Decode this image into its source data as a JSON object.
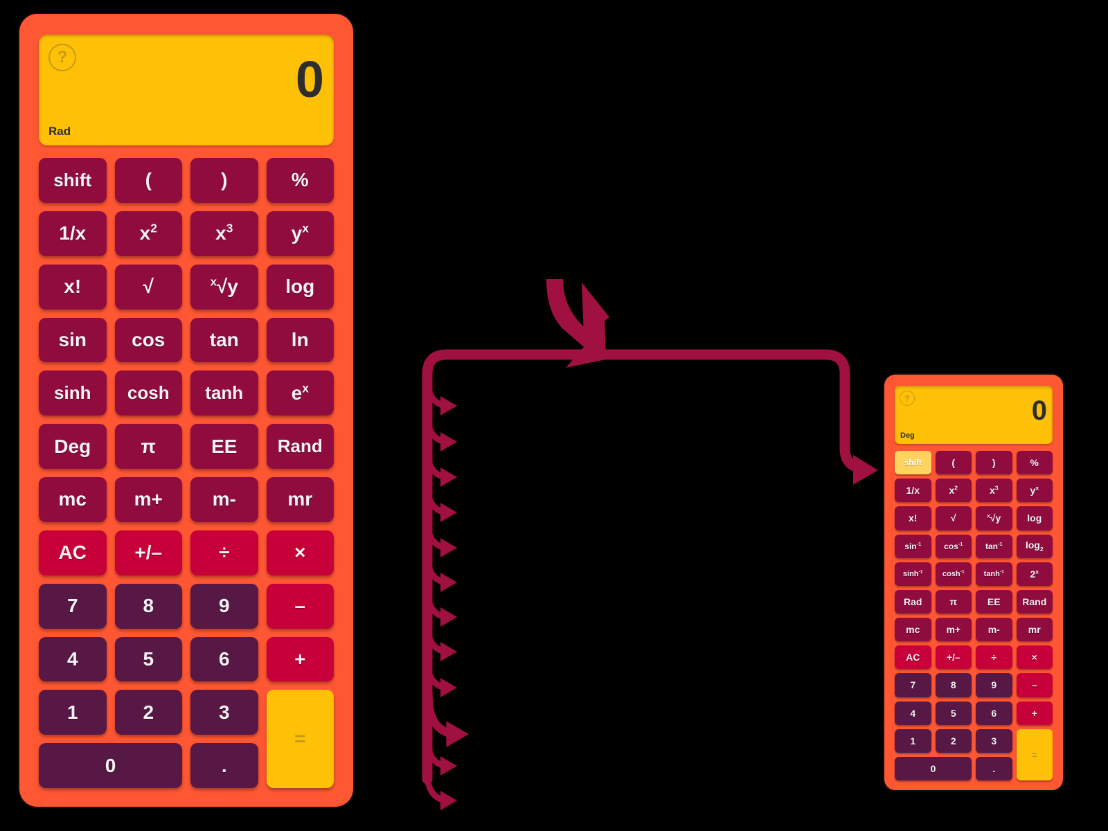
{
  "accent_colors": {
    "body": "#ff5733",
    "display": "#ffc107",
    "function_key": "#900c3f",
    "operator_key": "#c70039",
    "number_key": "#581845",
    "equals_key": "#ffc107",
    "active_key": "#ffd45e",
    "annotation": "#a01040"
  },
  "calculator_main": {
    "name": "scientific-calculator-unshifted",
    "display": {
      "help_icon": "question-mark-icon",
      "value": "0",
      "mode": "Rad"
    },
    "rows": [
      [
        {
          "label": "shift",
          "type": "fn",
          "state": "normal"
        },
        {
          "label": "(",
          "type": "fn",
          "state": "normal"
        },
        {
          "label": ")",
          "type": "fn",
          "state": "normal"
        },
        {
          "label": "%",
          "type": "fn",
          "state": "normal"
        }
      ],
      [
        {
          "label": "1/x",
          "type": "fn",
          "state": "normal"
        },
        {
          "label": "x2",
          "type": "fn",
          "state": "normal",
          "base": "x",
          "sup": "2"
        },
        {
          "label": "x3",
          "type": "fn",
          "state": "normal",
          "base": "x",
          "sup": "3"
        },
        {
          "label": "yx",
          "type": "fn",
          "state": "normal",
          "base": "y",
          "sup": "x"
        }
      ],
      [
        {
          "label": "x!",
          "type": "fn",
          "state": "normal"
        },
        {
          "label": "√",
          "type": "fn",
          "state": "normal"
        },
        {
          "label": "x√y",
          "type": "fn",
          "state": "normal",
          "pre": "x",
          "base": "√y"
        },
        {
          "label": "log",
          "type": "fn",
          "state": "normal"
        }
      ],
      [
        {
          "label": "sin",
          "type": "fn",
          "state": "normal"
        },
        {
          "label": "cos",
          "type": "fn",
          "state": "normal"
        },
        {
          "label": "tan",
          "type": "fn",
          "state": "normal"
        },
        {
          "label": "ln",
          "type": "fn",
          "state": "normal"
        }
      ],
      [
        {
          "label": "sinh",
          "type": "fn",
          "state": "normal"
        },
        {
          "label": "cosh",
          "type": "fn",
          "state": "normal"
        },
        {
          "label": "tanh",
          "type": "fn",
          "state": "normal"
        },
        {
          "label": "ex",
          "type": "fn",
          "state": "normal",
          "base": "e",
          "sup": "x"
        }
      ],
      [
        {
          "label": "Deg",
          "type": "fn",
          "state": "normal"
        },
        {
          "label": "π",
          "type": "fn",
          "state": "normal"
        },
        {
          "label": "EE",
          "type": "fn",
          "state": "normal"
        },
        {
          "label": "Rand",
          "type": "fn",
          "state": "normal"
        }
      ],
      [
        {
          "label": "mc",
          "type": "fn",
          "state": "normal"
        },
        {
          "label": "m+",
          "type": "fn",
          "state": "normal"
        },
        {
          "label": "m-",
          "type": "fn",
          "state": "normal"
        },
        {
          "label": "mr",
          "type": "fn",
          "state": "normal"
        }
      ],
      [
        {
          "label": "AC",
          "type": "op",
          "state": "normal"
        },
        {
          "label": "+/–",
          "type": "op",
          "state": "normal"
        },
        {
          "label": "÷",
          "type": "op",
          "state": "normal"
        },
        {
          "label": "×",
          "type": "op",
          "state": "normal"
        }
      ],
      [
        {
          "label": "7",
          "type": "num",
          "state": "normal"
        },
        {
          "label": "8",
          "type": "num",
          "state": "normal"
        },
        {
          "label": "9",
          "type": "num",
          "state": "normal"
        },
        {
          "label": "–",
          "type": "op",
          "state": "normal"
        }
      ],
      [
        {
          "label": "4",
          "type": "num",
          "state": "normal"
        },
        {
          "label": "5",
          "type": "num",
          "state": "normal"
        },
        {
          "label": "6",
          "type": "num",
          "state": "normal"
        },
        {
          "label": "+",
          "type": "op",
          "state": "normal"
        }
      ],
      [
        {
          "label": "1",
          "type": "num",
          "state": "normal"
        },
        {
          "label": "2",
          "type": "num",
          "state": "normal"
        },
        {
          "label": "3",
          "type": "num",
          "state": "normal"
        },
        {
          "label": "=",
          "type": "eq",
          "state": "normal",
          "span": "2r"
        }
      ],
      [
        {
          "label": "0",
          "type": "num",
          "state": "normal",
          "span": "2c"
        },
        {
          "label": ".",
          "type": "num",
          "state": "normal"
        }
      ]
    ]
  },
  "calculator_shifted": {
    "name": "scientific-calculator-shifted",
    "display": {
      "help_icon": "question-mark-icon",
      "value": "0",
      "mode": "Deg"
    },
    "rows": [
      [
        {
          "label": "shift",
          "type": "fn",
          "state": "active"
        },
        {
          "label": "(",
          "type": "fn",
          "state": "normal"
        },
        {
          "label": ")",
          "type": "fn",
          "state": "normal"
        },
        {
          "label": "%",
          "type": "fn",
          "state": "normal"
        }
      ],
      [
        {
          "label": "1/x",
          "type": "fn",
          "state": "normal"
        },
        {
          "label": "x2",
          "type": "fn",
          "state": "normal",
          "base": "x",
          "sup": "2"
        },
        {
          "label": "x3",
          "type": "fn",
          "state": "normal",
          "base": "x",
          "sup": "3"
        },
        {
          "label": "yx",
          "type": "fn",
          "state": "normal",
          "base": "y",
          "sup": "x"
        }
      ],
      [
        {
          "label": "x!",
          "type": "fn",
          "state": "normal"
        },
        {
          "label": "√",
          "type": "fn",
          "state": "normal"
        },
        {
          "label": "x√y",
          "type": "fn",
          "state": "normal",
          "pre": "x",
          "base": "√y"
        },
        {
          "label": "log",
          "type": "fn",
          "state": "normal"
        }
      ],
      [
        {
          "label": "sin-1",
          "type": "fn",
          "state": "normal",
          "base": "sin",
          "sup": "-1"
        },
        {
          "label": "cos-1",
          "type": "fn",
          "state": "normal",
          "base": "cos",
          "sup": "-1"
        },
        {
          "label": "tan-1",
          "type": "fn",
          "state": "normal",
          "base": "tan",
          "sup": "-1"
        },
        {
          "label": "log2",
          "type": "fn",
          "state": "normal",
          "base": "log",
          "sub": "2"
        }
      ],
      [
        {
          "label": "sinh-1",
          "type": "fn",
          "state": "normal",
          "base": "sinh",
          "sup": "-1"
        },
        {
          "label": "cosh-1",
          "type": "fn",
          "state": "normal",
          "base": "cosh",
          "sup": "-1"
        },
        {
          "label": "tanh-1",
          "type": "fn",
          "state": "normal",
          "base": "tanh",
          "sup": "-1"
        },
        {
          "label": "2x",
          "type": "fn",
          "state": "normal",
          "base": "2",
          "sup": "x"
        }
      ],
      [
        {
          "label": "Rad",
          "type": "fn",
          "state": "normal"
        },
        {
          "label": "π",
          "type": "fn",
          "state": "normal"
        },
        {
          "label": "EE",
          "type": "fn",
          "state": "normal"
        },
        {
          "label": "Rand",
          "type": "fn",
          "state": "normal"
        }
      ],
      [
        {
          "label": "mc",
          "type": "fn",
          "state": "normal"
        },
        {
          "label": "m+",
          "type": "fn",
          "state": "normal"
        },
        {
          "label": "m-",
          "type": "fn",
          "state": "normal"
        },
        {
          "label": "mr",
          "type": "fn",
          "state": "normal"
        }
      ],
      [
        {
          "label": "AC",
          "type": "op",
          "state": "normal"
        },
        {
          "label": "+/–",
          "type": "op",
          "state": "normal"
        },
        {
          "label": "÷",
          "type": "op",
          "state": "normal"
        },
        {
          "label": "×",
          "type": "op",
          "state": "normal"
        }
      ],
      [
        {
          "label": "7",
          "type": "num",
          "state": "normal"
        },
        {
          "label": "8",
          "type": "num",
          "state": "normal"
        },
        {
          "label": "9",
          "type": "num",
          "state": "normal"
        },
        {
          "label": "–",
          "type": "op",
          "state": "normal"
        }
      ],
      [
        {
          "label": "4",
          "type": "num",
          "state": "normal"
        },
        {
          "label": "5",
          "type": "num",
          "state": "normal"
        },
        {
          "label": "6",
          "type": "num",
          "state": "normal"
        },
        {
          "label": "+",
          "type": "op",
          "state": "normal"
        }
      ],
      [
        {
          "label": "1",
          "type": "num",
          "state": "normal"
        },
        {
          "label": "2",
          "type": "num",
          "state": "normal"
        },
        {
          "label": "3",
          "type": "num",
          "state": "normal"
        },
        {
          "label": "=",
          "type": "eq",
          "state": "normal",
          "span": "2r"
        }
      ],
      [
        {
          "label": "0",
          "type": "num",
          "state": "normal",
          "span": "2c"
        },
        {
          "label": ".",
          "type": "num",
          "state": "normal"
        }
      ]
    ]
  },
  "annotations": {
    "branch_arrow_count": 12,
    "arrows": [
      {
        "name": "pointer-arrow-top",
        "kind": "curved-right"
      },
      {
        "name": "flow-connector-arrow",
        "kind": "bracket-right"
      },
      {
        "name": "branch-arrow",
        "kind": "small-curved-right"
      }
    ]
  }
}
